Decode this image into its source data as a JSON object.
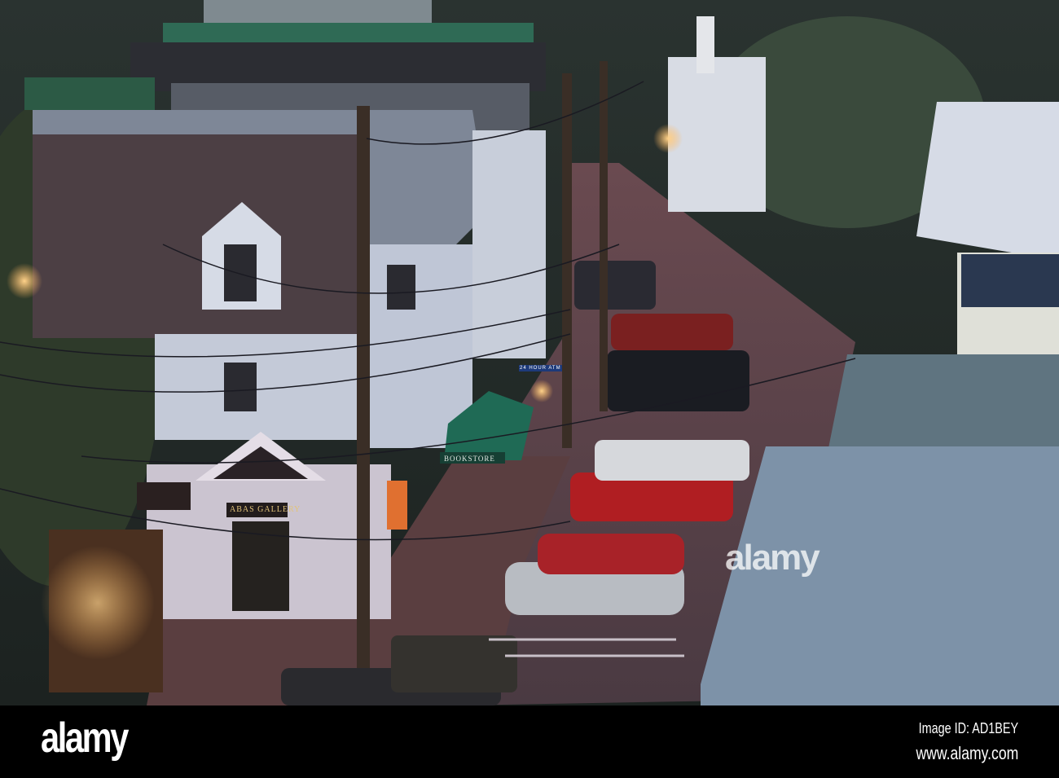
{
  "photo": {
    "watermark": "alamy",
    "signs": {
      "bookstore": "BOOKSTORE",
      "gallery": "ABAS GALLERY",
      "atm": "24 HOUR ATM"
    }
  },
  "footer": {
    "logo": "alamy",
    "image_id": "Image ID: AD1BEY",
    "website": "www.alamy.com"
  }
}
